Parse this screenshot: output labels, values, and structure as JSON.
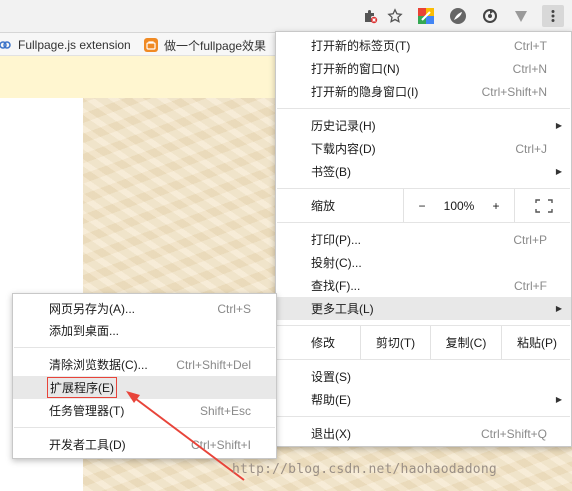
{
  "toolbar": {
    "icons": [
      "extension-puzzle-icon",
      "star-icon",
      "colorful-app-icon",
      "feather-icon",
      "sync-icon",
      "filter-icon",
      "more-vert-icon"
    ]
  },
  "bookmarks": [
    {
      "label": "Fullpage.js extension",
      "icon": "extension-link-icon"
    },
    {
      "label": "做一个fullpage效果",
      "icon": "orange-site-icon"
    }
  ],
  "chrome_menu": {
    "new_tab": {
      "label": "打开新的标签页(T)",
      "shortcut": "Ctrl+T"
    },
    "new_window": {
      "label": "打开新的窗口(N)",
      "shortcut": "Ctrl+N"
    },
    "incognito": {
      "label": "打开新的隐身窗口(I)",
      "shortcut": "Ctrl+Shift+N"
    },
    "history": {
      "label": "历史记录(H)",
      "arrow": "▶"
    },
    "downloads": {
      "label": "下载内容(D)",
      "shortcut": "Ctrl+J"
    },
    "bookmarks": {
      "label": "书签(B)",
      "arrow": "▶"
    },
    "zoom": {
      "label": "缩放",
      "minus": "−",
      "value": "100%",
      "plus": "+"
    },
    "print": {
      "label": "打印(P)...",
      "shortcut": "Ctrl+P"
    },
    "cast": {
      "label": "投射(C)..."
    },
    "find": {
      "label": "查找(F)...",
      "shortcut": "Ctrl+F"
    },
    "more_tools": {
      "label": "更多工具(L)",
      "arrow": "▶"
    },
    "edit": {
      "label": "修改",
      "cut": "剪切(T)",
      "copy": "复制(C)",
      "paste": "粘贴(P)"
    },
    "settings": {
      "label": "设置(S)"
    },
    "help": {
      "label": "帮助(E)",
      "arrow": "▶"
    },
    "exit": {
      "label": "退出(X)",
      "shortcut": "Ctrl+Shift+Q"
    }
  },
  "submenu": {
    "save_page": {
      "label": "网页另存为(A)...",
      "shortcut": "Ctrl+S"
    },
    "add_desktop": {
      "label": "添加到桌面..."
    },
    "clear_data": {
      "label": "清除浏览数据(C)...",
      "shortcut": "Ctrl+Shift+Del"
    },
    "extensions": {
      "label": "扩展程序(E)"
    },
    "task_manager": {
      "label": "任务管理器(T)",
      "shortcut": "Shift+Esc"
    },
    "dev_tools": {
      "label": "开发者工具(D)",
      "shortcut": "Ctrl+Shift+I"
    }
  },
  "watermark": "http://blog.csdn.net/haohaodadong",
  "colors": {
    "annotation_red": "#e8443a"
  }
}
